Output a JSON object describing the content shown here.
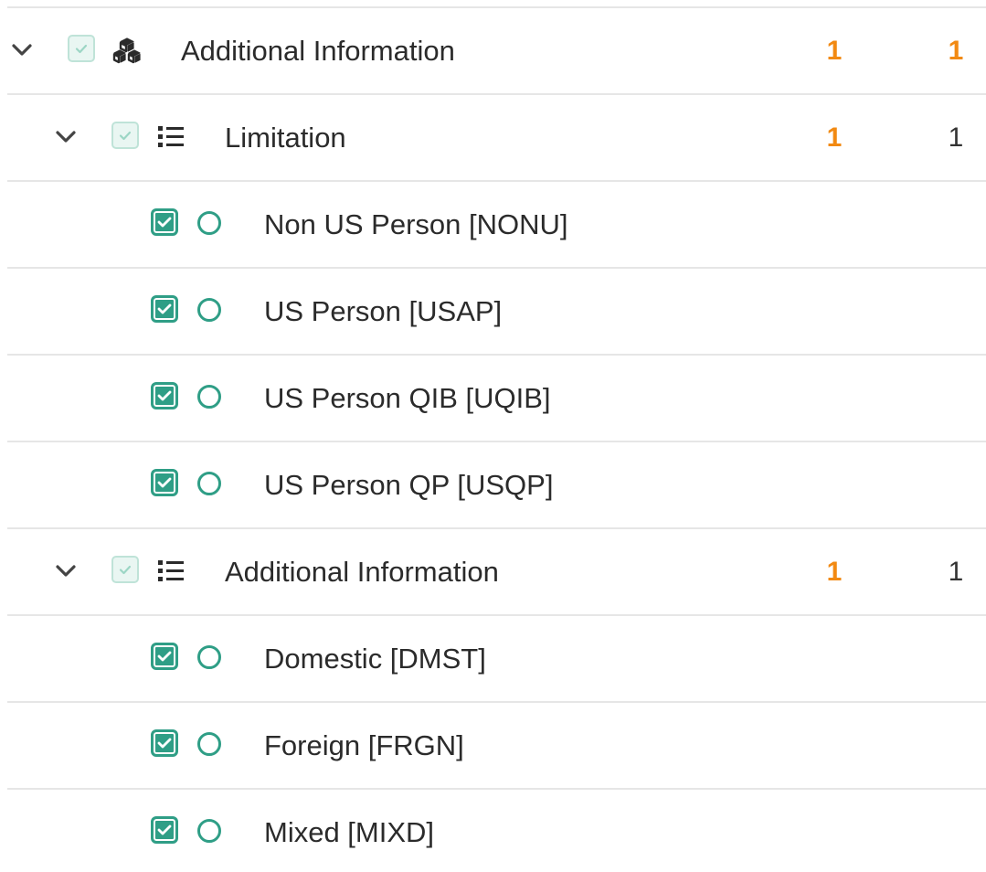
{
  "colors": {
    "accent": "#2f9e86",
    "count_orange": "#f28a13",
    "divider": "#e6e6e6"
  },
  "rows": [
    {
      "label": "Additional Information",
      "count_a": "1",
      "count_b": "1",
      "expanded": true,
      "checkbox": "partial",
      "icon": "cubes-icon"
    },
    {
      "label": "Limitation",
      "count_a": "1",
      "count_b": "1",
      "expanded": true,
      "checkbox": "partial",
      "icon": "list-icon"
    },
    {
      "label": "Non US Person [NONU]",
      "checkbox": "checked",
      "icon": "radio-circle-icon"
    },
    {
      "label": "US Person [USAP]",
      "checkbox": "checked",
      "icon": "radio-circle-icon"
    },
    {
      "label": "US Person QIB [UQIB]",
      "checkbox": "checked",
      "icon": "radio-circle-icon"
    },
    {
      "label": "US Person QP [USQP]",
      "checkbox": "checked",
      "icon": "radio-circle-icon"
    },
    {
      "label": "Additional Information",
      "count_a": "1",
      "count_b": "1",
      "expanded": true,
      "checkbox": "partial",
      "icon": "list-icon"
    },
    {
      "label": "Domestic [DMST]",
      "checkbox": "checked",
      "icon": "radio-circle-icon"
    },
    {
      "label": "Foreign [FRGN]",
      "checkbox": "checked",
      "icon": "radio-circle-icon"
    },
    {
      "label": "Mixed [MIXD]",
      "checkbox": "checked",
      "icon": "radio-circle-icon"
    }
  ]
}
